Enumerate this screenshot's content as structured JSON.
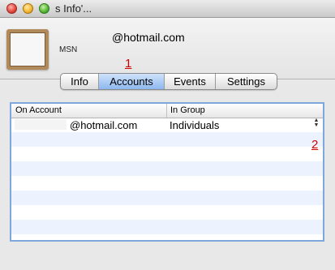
{
  "window": {
    "title": "s Info'..."
  },
  "contact": {
    "name": "@hotmail.com",
    "service": "MSN"
  },
  "tabs": [
    {
      "label": "Info",
      "active": false
    },
    {
      "label": "Accounts",
      "active": true
    },
    {
      "label": "Events",
      "active": false
    },
    {
      "label": "Settings",
      "active": false
    }
  ],
  "annotations": {
    "marker1": "1",
    "marker2": "2"
  },
  "table": {
    "headers": {
      "account": "On Account",
      "group": "In Group"
    },
    "rows": [
      {
        "account": "@hotmail.com",
        "group": "Individuals"
      }
    ]
  },
  "colors": {
    "accent": "#8db8ee",
    "annotation": "#d00000",
    "table_border": "#7ea7dc"
  }
}
